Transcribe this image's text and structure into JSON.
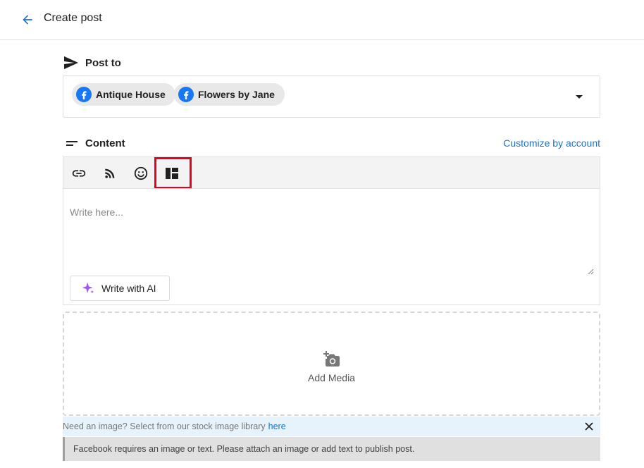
{
  "header": {
    "title": "Create post",
    "back_icon": "arrow-left-icon"
  },
  "post_to": {
    "label": "Post to",
    "icon": "send-icon",
    "accounts": [
      {
        "name": "Antique House",
        "network": "facebook"
      },
      {
        "name": "Flowers by Jane",
        "network": "facebook"
      }
    ]
  },
  "content": {
    "label": "Content",
    "icon": "short-text-icon",
    "customize_link": "Customize by account",
    "toolbar": [
      "link-icon",
      "rss-icon",
      "emoji-icon",
      "layout-template-icon"
    ],
    "placeholder": "Write here...",
    "ai_button": "Write with AI"
  },
  "media": {
    "label": "Add Media",
    "icon": "add-photo-icon"
  },
  "stock": {
    "text": "Need an image? Select from our stock image library",
    "link": "here"
  },
  "warning": {
    "text": "Facebook requires an image or text. Please attach an image or add text to publish post."
  },
  "colors": {
    "accent": "#1a73c8",
    "facebook": "#1877f2",
    "highlight": "#e8001c"
  }
}
